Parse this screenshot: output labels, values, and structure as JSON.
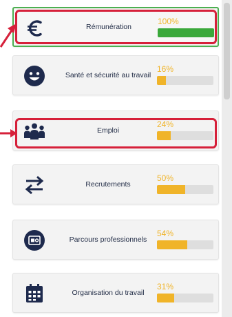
{
  "colors": {
    "progress_yellow": "#f0b429",
    "progress_green": "#3aa83a",
    "track": "#dedede",
    "selected_border": "#4caf50",
    "annotation_red": "#d6203a",
    "icon_dark": "#1e2a4d"
  },
  "topics": [
    {
      "label": "Rémunération",
      "percent": "100%",
      "progress": 1.0,
      "icon": "euro-icon",
      "selected": true
    },
    {
      "label": "Santé et sécurité au travail",
      "percent": "16%",
      "progress": 0.16,
      "icon": "smiley-face-icon",
      "selected": false
    },
    {
      "label": "Emploi",
      "percent": "24%",
      "progress": 0.24,
      "icon": "people-group-icon",
      "selected": false
    },
    {
      "label": "Recrutements",
      "percent": "50%",
      "progress": 0.5,
      "icon": "swap-arrows-icon",
      "selected": false
    },
    {
      "label": "Parcours professionnels",
      "percent": "54%",
      "progress": 0.54,
      "icon": "career-path-icon",
      "selected": false
    },
    {
      "label": "Organisation du travail",
      "percent": "31%",
      "progress": 0.31,
      "icon": "calendar-icon",
      "selected": false
    }
  ],
  "annotations": [
    {
      "target": "Rémunération",
      "type": "red-box-with-arrow"
    },
    {
      "target": "Emploi",
      "type": "red-box-with-arrow"
    }
  ]
}
